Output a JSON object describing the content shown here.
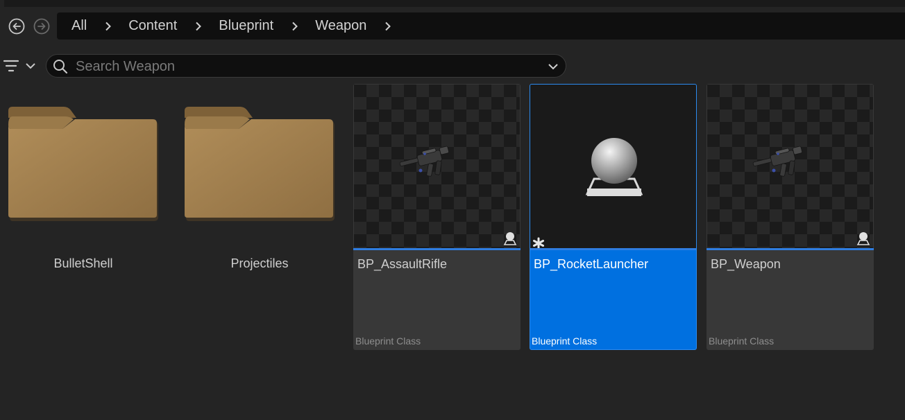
{
  "navigation": {
    "back_icon": "back-circle-arrow-icon",
    "forward_icon": "forward-circle-arrow-icon"
  },
  "breadcrumb": [
    "All",
    "Content",
    "Blueprint",
    "Weapon"
  ],
  "search": {
    "placeholder": "Search Weapon",
    "value": ""
  },
  "filter": {
    "icon": "filter-lines-icon"
  },
  "items": {
    "folders": [
      {
        "label": "BulletShell"
      },
      {
        "label": "Projectiles"
      }
    ],
    "assets": [
      {
        "name": "BP_AssaultRifle",
        "type": "Blueprint Class",
        "thumbnail": "rifle",
        "selected": false
      },
      {
        "name": "BP_RocketLauncher",
        "type": "Blueprint Class",
        "thumbnail": "sphere",
        "selected": true
      },
      {
        "name": "BP_Weapon",
        "type": "Blueprint Class",
        "thumbnail": "rifle",
        "selected": false
      }
    ]
  },
  "colors": {
    "background": "#242424",
    "selection": "#0070e0",
    "asset_bar": "#2f7de0",
    "folder": "#a88554"
  }
}
